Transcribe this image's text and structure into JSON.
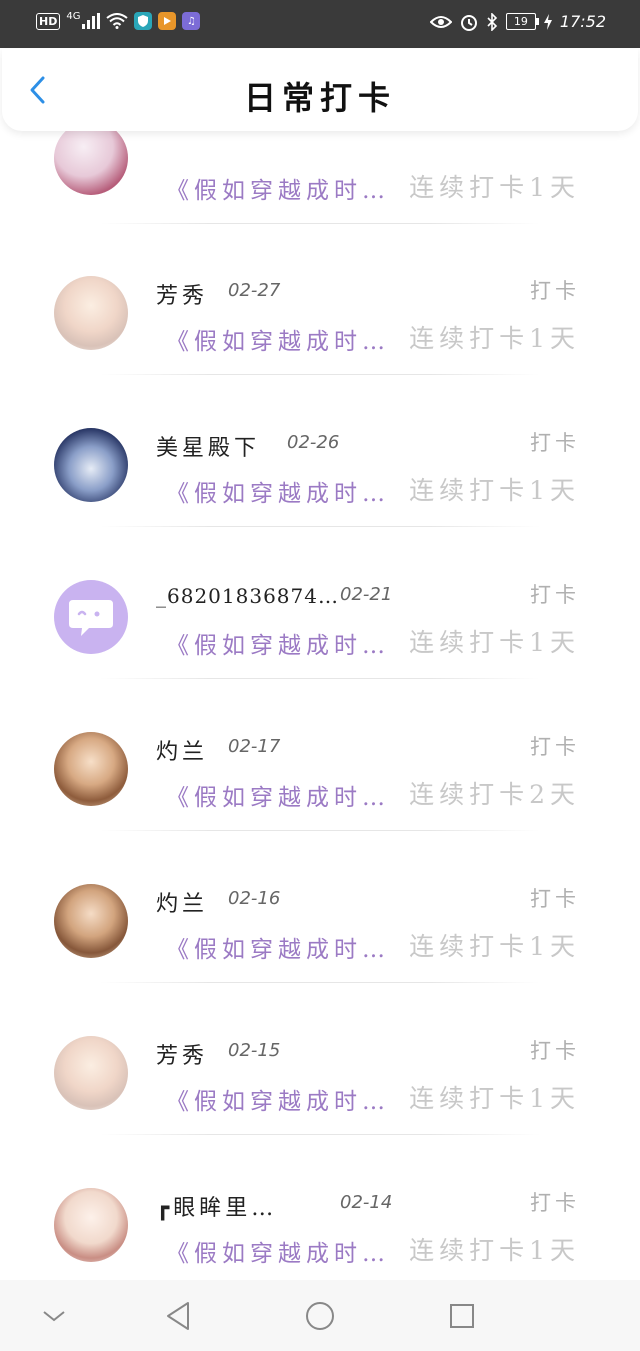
{
  "status_bar": {
    "network_hd": "HD",
    "network_4g": "4G",
    "battery_level": "19",
    "time": "17:52"
  },
  "header": {
    "title": "日常打卡",
    "back_icon": "chevron-left-icon",
    "accent_color": "#2d8fe6"
  },
  "checkins": [
    {
      "name": "",
      "date": "",
      "tag": "",
      "book": "《假如穿越成时…",
      "streak": "连续打卡1天",
      "avatar": "anime-girl-avatar"
    },
    {
      "name": "芳秀",
      "date": "02-27",
      "tag": "打卡",
      "book": "《假如穿越成时…",
      "streak": "连续打卡1天",
      "avatar": "anime-boy-avatar"
    },
    {
      "name": "美星殿下",
      "date": "02-26",
      "tag": "打卡",
      "book": "《假如穿越成时…",
      "streak": "连续打卡1天",
      "avatar": "anime-character-avatar"
    },
    {
      "name": "_68201836874…",
      "date": "02-21",
      "tag": "打卡",
      "book": "《假如穿越成时…",
      "streak": "连续打卡1天",
      "avatar": "default-chat-avatar"
    },
    {
      "name": "灼兰",
      "date": "02-17",
      "tag": "打卡",
      "book": "《假如穿越成时…",
      "streak": "连续打卡2天",
      "avatar": "anime-girl-avatar"
    },
    {
      "name": "灼兰",
      "date": "02-16",
      "tag": "打卡",
      "book": "《假如穿越成时…",
      "streak": "连续打卡1天",
      "avatar": "anime-girl-avatar"
    },
    {
      "name": "芳秀",
      "date": "02-15",
      "tag": "打卡",
      "book": "《假如穿越成时…",
      "streak": "连续打卡1天",
      "avatar": "anime-boy-avatar"
    },
    {
      "name": "┏眼眸里…",
      "date": "02-14",
      "tag": "打卡",
      "book": "《假如穿越成时…",
      "streak": "连续打卡1天",
      "avatar": "anime-girl-avatar"
    }
  ],
  "colors": {
    "book_title": "#9b7ac4",
    "streak_text": "#c8c8c8",
    "default_avatar": "#c9b3f0"
  },
  "nav": {
    "items": [
      "collapse-icon",
      "back-triangle-icon",
      "home-circle-icon",
      "recent-square-icon"
    ]
  }
}
